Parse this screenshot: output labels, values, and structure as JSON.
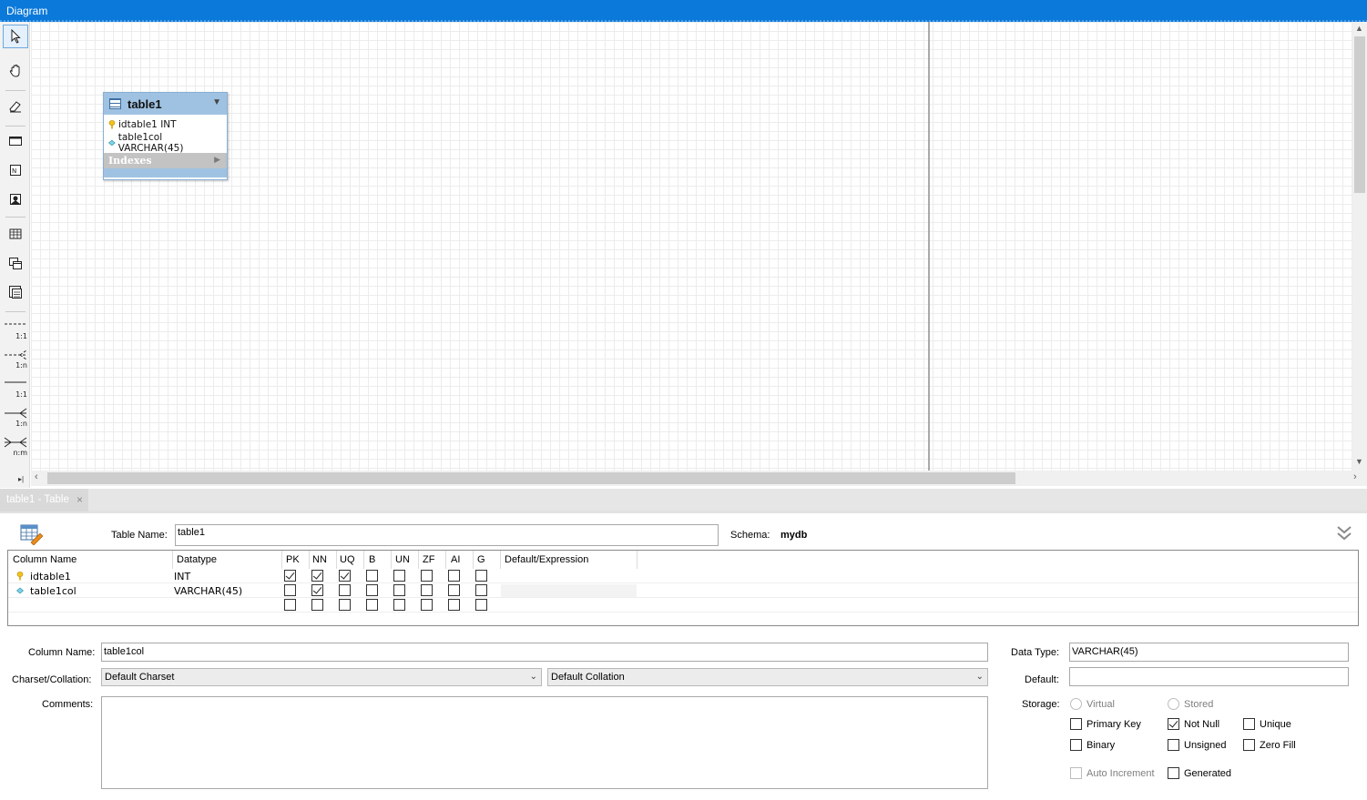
{
  "window": {
    "title": "Diagram"
  },
  "toolbar": {
    "tools": [
      "pointer-tool",
      "hand-tool",
      "eraser-tool",
      "layer-tool",
      "text-note-tool",
      "image-tool",
      "table-tool",
      "view-tool",
      "routine-group-tool"
    ],
    "relations": [
      "1:1",
      "1:n",
      "1:1",
      "1:n",
      "n:m"
    ]
  },
  "figure": {
    "title": "table1",
    "columns": [
      {
        "icon": "primary-key-icon",
        "text": "idtable1 INT"
      },
      {
        "icon": "column-diamond-icon",
        "text": "table1col VARCHAR(45)"
      }
    ],
    "indexes_label": "Indexes"
  },
  "tab": {
    "label": "table1 - Table",
    "close": "×"
  },
  "editor": {
    "table_name_label": "Table Name:",
    "table_name": "table1",
    "schema_label": "Schema:",
    "schema": "mydb",
    "grid": {
      "headers": [
        "Column Name",
        "Datatype",
        "PK",
        "NN",
        "UQ",
        "B",
        "UN",
        "ZF",
        "AI",
        "G",
        "Default/Expression"
      ],
      "rows": [
        {
          "name": "idtable1",
          "type": "INT",
          "icon": "primary-key-icon",
          "flags": [
            true,
            true,
            true,
            false,
            false,
            false,
            false,
            false
          ]
        },
        {
          "name": "table1col",
          "type": "VARCHAR(45)",
          "icon": "column-diamond-icon",
          "flags": [
            false,
            true,
            false,
            false,
            false,
            false,
            false,
            false
          ]
        },
        {
          "name": "",
          "type": "",
          "icon": "",
          "flags": [
            false,
            false,
            false,
            false,
            false,
            false,
            false,
            false
          ]
        }
      ]
    },
    "details": {
      "column_name_label": "Column Name:",
      "column_name": "table1col",
      "charset_label": "Charset/Collation:",
      "charset": "Default Charset",
      "collation": "Default Collation",
      "comments_label": "Comments:",
      "data_type_label": "Data Type:",
      "data_type": "VARCHAR(45)",
      "default_label": "Default:",
      "default_value": "",
      "storage_label": "Storage:",
      "virtual": "Virtual",
      "stored": "Stored",
      "primary_key": "Primary Key",
      "not_null": "Not Null",
      "unique": "Unique",
      "binary": "Binary",
      "unsigned": "Unsigned",
      "zero_fill": "Zero Fill",
      "auto_increment": "Auto Increment",
      "generated": "Generated"
    }
  },
  "colors": {
    "accent": "#0a79d9",
    "figure_header": "#9fc2e2"
  }
}
